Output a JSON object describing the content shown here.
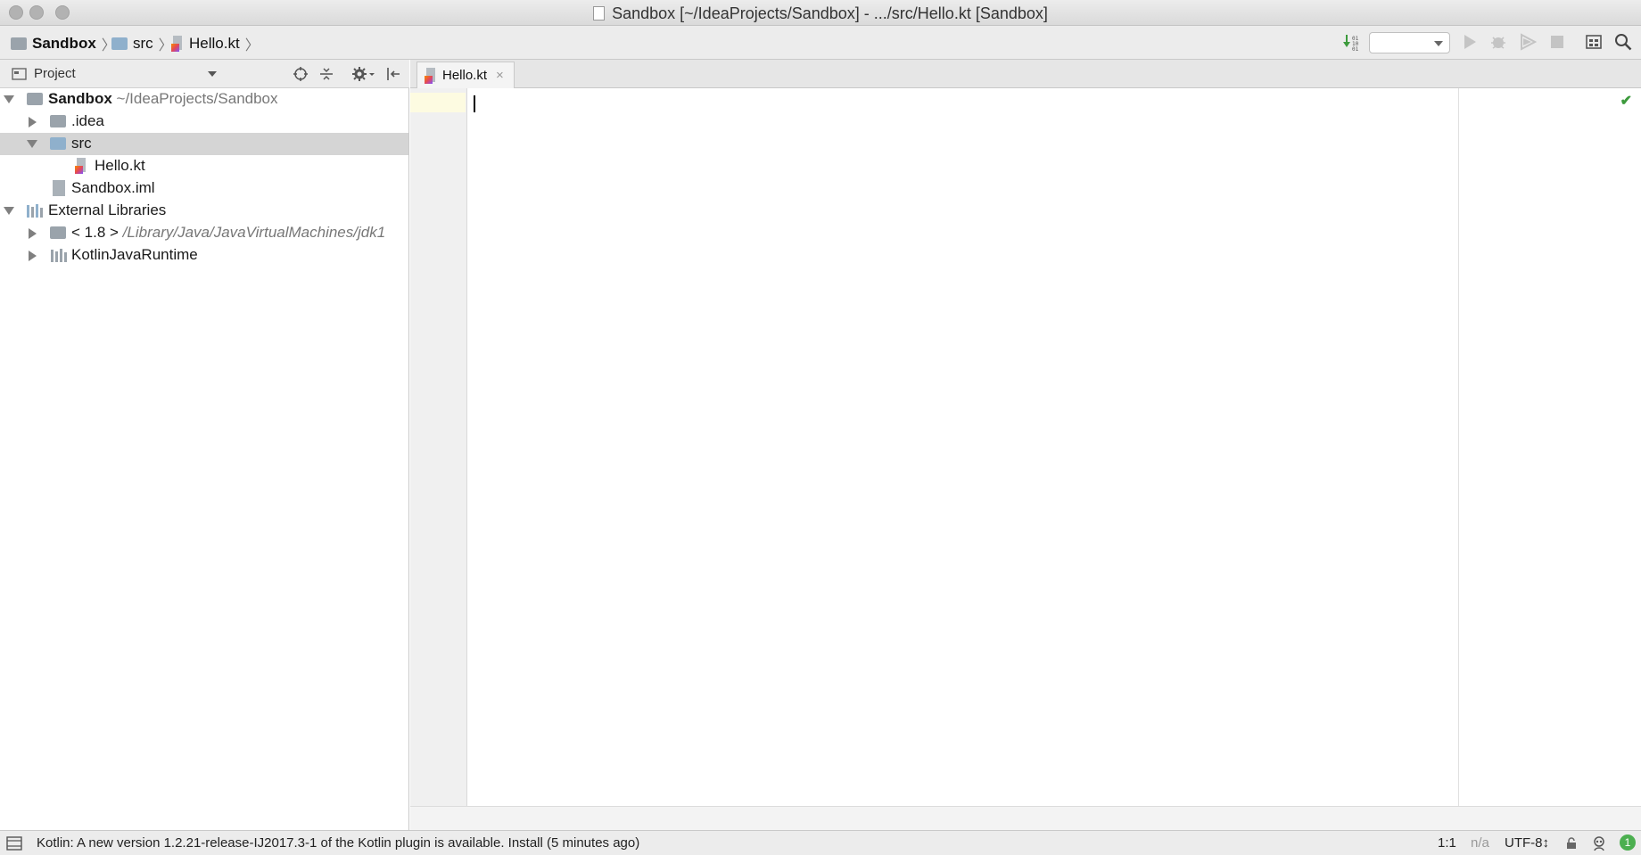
{
  "window": {
    "title": "Sandbox [~/IdeaProjects/Sandbox] - .../src/Hello.kt [Sandbox]"
  },
  "breadcrumbs": [
    "Sandbox",
    "src",
    "Hello.kt"
  ],
  "project_panel": {
    "title": "Project"
  },
  "tree": [
    {
      "label": "Sandbox",
      "sub": "~/IdeaProjects/Sandbox"
    },
    {
      "label": ".idea"
    },
    {
      "label": "src"
    },
    {
      "label": "Hello.kt"
    },
    {
      "label": "Sandbox.iml"
    },
    {
      "label": "External Libraries"
    },
    {
      "label": "< 1.8 >",
      "sub": "/Library/Java/JavaVirtualMachines/jdk1"
    },
    {
      "label": "KotlinJavaRuntime"
    }
  ],
  "editor": {
    "tab_label": "Hello.kt",
    "tab_close": "×"
  },
  "statusbar": {
    "message": "Kotlin: A new version 1.2.21-release-IJ2017.3-1 of the Kotlin plugin is available. Install (5 minutes ago)",
    "position": "1:1",
    "na": "n/a",
    "encoding": "UTF-8↕",
    "notifications": "1"
  },
  "colors": {
    "accent_folder": "#8fb0cc",
    "selection": "#d5d5d5",
    "ok": "#3c9a3c"
  }
}
